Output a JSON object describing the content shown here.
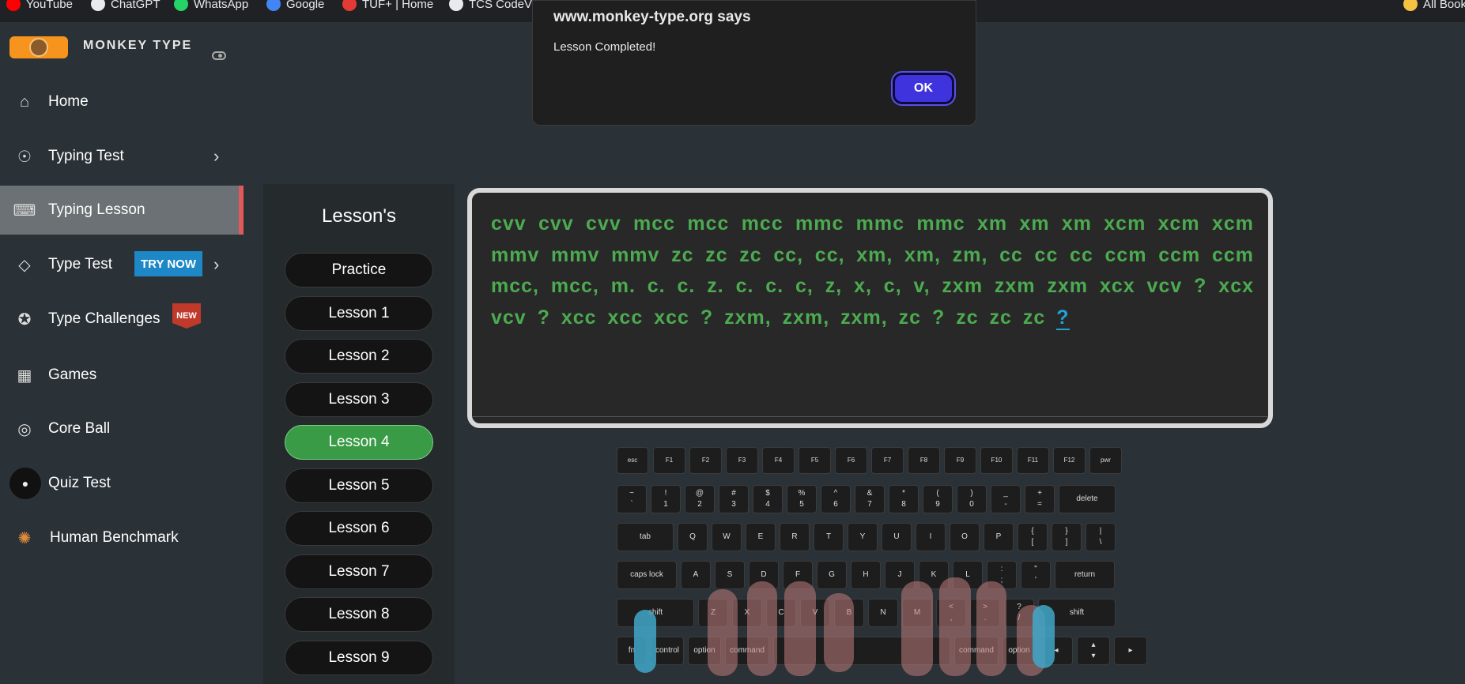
{
  "bookmarks": [
    {
      "label": "YouTube",
      "icon": "youtube-icon",
      "color": "#ff0000"
    },
    {
      "label": "ChatGPT",
      "icon": "chatgpt-icon",
      "color": "#e8eaed"
    },
    {
      "label": "WhatsApp",
      "icon": "whatsapp-icon",
      "color": "#25d366"
    },
    {
      "label": "Google",
      "icon": "google-icon",
      "color": "#4285f4"
    },
    {
      "label": "TUF+ | Home",
      "icon": "tuf-icon",
      "color": "#e53935"
    },
    {
      "label": "TCS CodeVi",
      "icon": "tcs-icon",
      "color": "#e8eaed"
    },
    {
      "label": "All Book",
      "icon": "folder-icon",
      "color": "#f6c244"
    }
  ],
  "sidebar": {
    "brand": "MONKEY TYPE",
    "items": [
      {
        "label": "Home",
        "icon": "home-icon"
      },
      {
        "label": "Typing Test",
        "icon": "github-icon",
        "chevron": "›"
      },
      {
        "label": "Typing Lesson",
        "icon": "keyboard-icon",
        "active": true
      },
      {
        "label": "Type Test",
        "icon": "gitlab-icon",
        "chevron": "›",
        "badge": "TRY NOW"
      },
      {
        "label": "Type Challenges",
        "icon": "award-icon",
        "badge": "NEW"
      },
      {
        "label": "Games",
        "icon": "grid-icon"
      },
      {
        "label": "Core Ball",
        "icon": "target-icon"
      },
      {
        "label": "Quiz Test",
        "icon": "quiz-avatar-icon"
      },
      {
        "label": "Human Benchmark",
        "icon": "brain-icon"
      }
    ]
  },
  "lessons": {
    "header": "Lesson's",
    "items": [
      "Practice",
      "Lesson 1",
      "Lesson 2",
      "Lesson 3",
      "Lesson 4",
      "Lesson 5",
      "Lesson 6",
      "Lesson 7",
      "Lesson 8",
      "Lesson 9"
    ],
    "current": "Lesson 4"
  },
  "typing": {
    "typed": "cvv cvv cvv mcc mcc mcc mmc mmc mmc xm xm xm xcm xcm xcm mmv mmv mmv zc zc zc cc, cc, xm, xm, zm, cc cc cc ccm ccm ccm mcc, mcc, m. c. c. z. c. c. c, z, x, c, v, zxm zxm zxm xcx vcv ? xcx vcv ? xcc xcc xcc ? zxm, zxm, zxm, zc ? zc zc zc",
    "cursor_char": "?",
    "typed_color": "#4caa50",
    "cursor_color": "#1fa3d6"
  },
  "keyboard": {
    "fn_row": [
      "esc",
      "F1",
      "F2",
      "F3",
      "F4",
      "F5",
      "F6",
      "F7",
      "F8",
      "F9",
      "F10",
      "F11",
      "F12",
      "pwr"
    ],
    "num_row": [
      [
        "~",
        "`"
      ],
      [
        "!",
        "1"
      ],
      [
        "@",
        "2"
      ],
      [
        "#",
        "3"
      ],
      [
        "$",
        "4"
      ],
      [
        "%",
        "5"
      ],
      [
        "^",
        "6"
      ],
      [
        "&",
        "7"
      ],
      [
        "*",
        "8"
      ],
      [
        "(",
        "9"
      ],
      [
        ")",
        "0"
      ],
      [
        "_",
        "-"
      ],
      [
        "+",
        "="
      ],
      [
        "",
        "delete"
      ]
    ],
    "q_row": [
      "tab",
      "Q",
      "W",
      "E",
      "R",
      "T",
      "Y",
      "U",
      "I",
      "O",
      "P",
      "{\n[",
      "}\n]",
      "|\n\\"
    ],
    "a_row": [
      "caps lock",
      "A",
      "S",
      "D",
      "F",
      "G",
      "H",
      "J",
      "K",
      "L",
      ":\n;",
      "\"\n'",
      "return"
    ],
    "z_row": [
      "shift",
      "Z",
      "X",
      "C",
      "V",
      "B",
      "N",
      "M",
      "<\n,",
      ">\n.",
      "?\n/",
      "shift"
    ],
    "bottom_row": [
      "fn",
      "control",
      "option",
      "command",
      "",
      "command",
      "option",
      "◂",
      "▴\n▾",
      "▸"
    ]
  },
  "dialog": {
    "title": "www.monkey-type.org says",
    "message": "Lesson Completed!",
    "ok_label": "OK"
  }
}
